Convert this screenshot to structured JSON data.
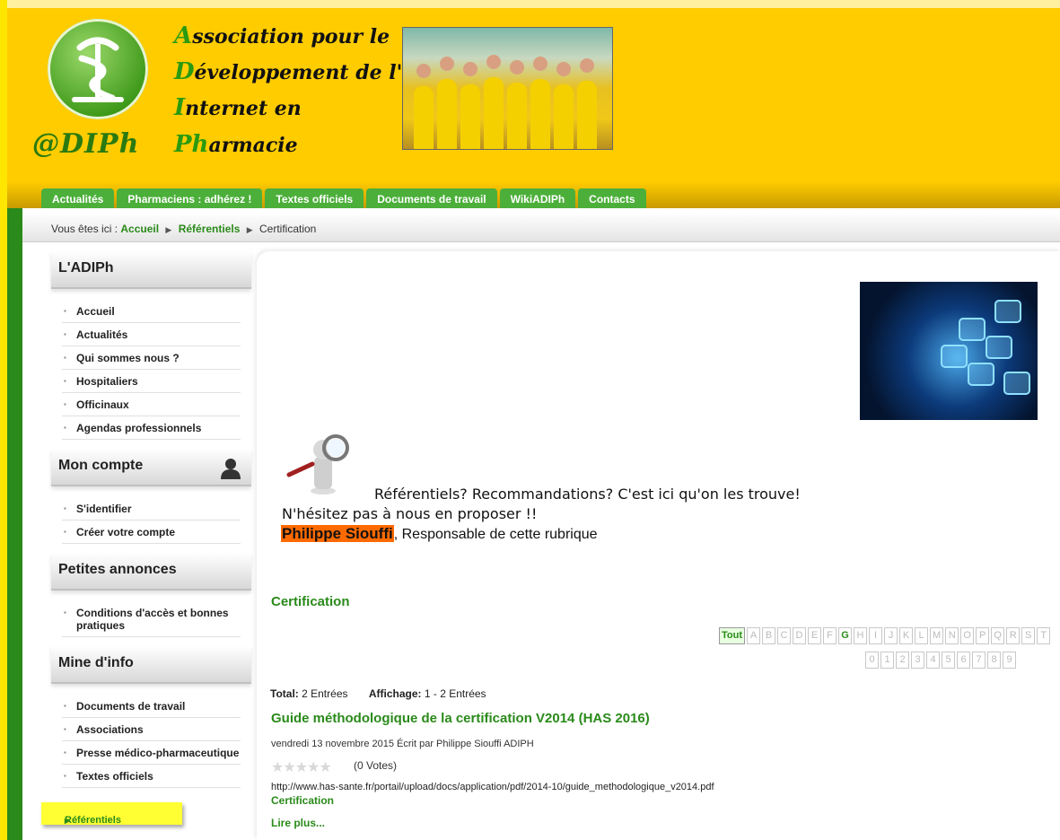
{
  "brand": {
    "logo_text": "@DIPh",
    "title_lines": [
      {
        "cap": "A",
        "rest": "ssociation pour le"
      },
      {
        "cap": "D",
        "rest": "éveloppement de l'"
      },
      {
        "cap": "I",
        "rest": "nternet en"
      },
      {
        "cap": "Ph",
        "rest": "armacie"
      }
    ]
  },
  "nav": {
    "tabs": [
      "Actualités",
      "Pharmaciens : adhérez !",
      "Textes officiels",
      "Documents de travail",
      "WikiADIPh",
      "Contacts"
    ]
  },
  "breadcrumb": {
    "prefix": "Vous êtes ici :",
    "items": [
      "Accueil",
      "Référentiels",
      "Certification"
    ]
  },
  "sidebar": {
    "modules": [
      {
        "title": "L'ADIPh",
        "items": [
          "Accueil",
          "Actualités",
          "Qui sommes nous ?",
          "Hospitaliers",
          "Officinaux",
          "Agendas professionnels"
        ]
      },
      {
        "title": "Mon compte",
        "items": [
          "S'identifier",
          "Créer votre compte"
        ]
      },
      {
        "title": "Petites annonces",
        "items": [
          "Conditions d'accès et bonnes pratiques"
        ]
      },
      {
        "title": "Mine d'info",
        "items": [
          "Documents de travail",
          "Associations",
          "Presse médico-pharmaceutique",
          "Textes officiels"
        ]
      }
    ],
    "active_item": "Référentiels"
  },
  "content": {
    "intro_line1": "Référentiels? Recommandations? C'est ici qu'on les trouve!",
    "intro_line2": "N'hésitez pas à nous en proposer !!",
    "responsible_name": "Philippe Siouffi",
    "responsible_suffix": ", Responsable de cette rubrique",
    "category_title": "Certification",
    "alphabet_all": "Tout",
    "alphabet_letters": [
      "A",
      "B",
      "C",
      "D",
      "E",
      "F",
      "G",
      "H",
      "I",
      "J",
      "K",
      "L",
      "M",
      "N",
      "O",
      "P",
      "Q",
      "R",
      "S",
      "T"
    ],
    "alphabet_active": "G",
    "alphabet_digits": [
      "0",
      "1",
      "2",
      "3",
      "4",
      "5",
      "6",
      "7",
      "8",
      "9"
    ],
    "total_label": "Total:",
    "total_value": "2 Entrées",
    "display_label": "Affichage:",
    "display_value": "1 - 2 Entrées",
    "entry": {
      "title": "Guide méthodologique de la certification V2014 (HAS 2016)",
      "meta": "vendredi 13 novembre 2015   Écrit par Philippe Siouffi ADIPH",
      "rating": 0,
      "votes": "(0 Votes)",
      "url": "http://www.has-sante.fr/portail/upload/docs/application/pdf/2014-10/guide_methodologique_v2014.pdf",
      "category": "Certification",
      "read_more": "Lire plus..."
    }
  },
  "colors": {
    "header_yellow": "#ffcc00",
    "brand_green": "#2a8a1a",
    "tab_green": "#4caf3a",
    "highlight_orange": "#ff6a00",
    "active_yellow": "#ffff33"
  }
}
